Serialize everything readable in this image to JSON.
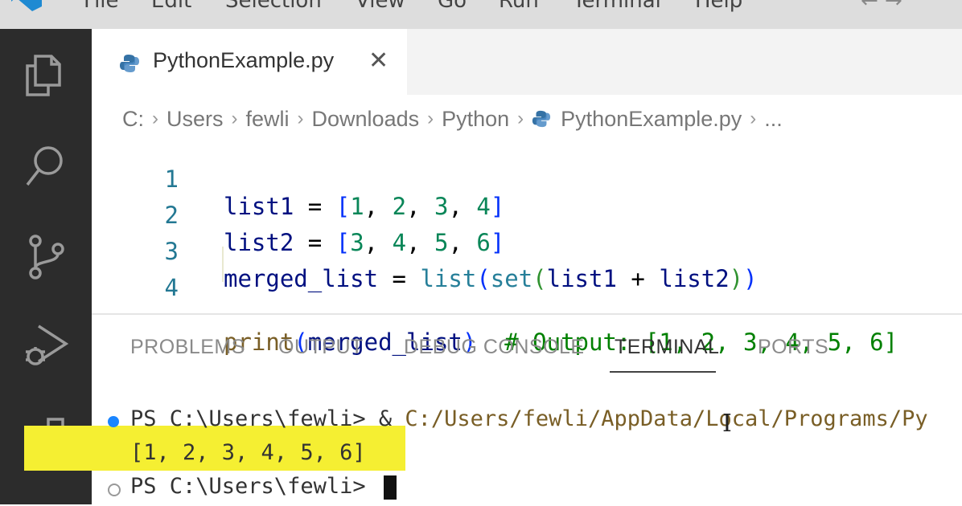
{
  "menubar": {
    "items": [
      "File",
      "Edit",
      "Selection",
      "View",
      "Go",
      "Run",
      "Terminal",
      "Help"
    ],
    "nav": "← →"
  },
  "activity": {
    "icons": [
      "explorer-icon",
      "search-icon",
      "source-control-icon",
      "run-debug-icon",
      "extensions-icon"
    ]
  },
  "tab": {
    "label": "PythonExample.py",
    "close": "✕"
  },
  "breadcrumb": {
    "parts": [
      "C:",
      "Users",
      "fewli",
      "Downloads",
      "Python"
    ],
    "file": "PythonExample.py",
    "more": "..."
  },
  "editor": {
    "lines": [
      {
        "num": "1",
        "text": "list1 = [1, 2, 3, 4]"
      },
      {
        "num": "2",
        "text": "list2 = [3, 4, 5, 6]"
      },
      {
        "num": "3",
        "text": "merged_list = list(set(list1 + list2))"
      },
      {
        "num": "4",
        "text": "print(merged_list)  # Output: [1, 2, 3, 4, 5, 6]"
      }
    ]
  },
  "panel": {
    "tabs": [
      "PROBLEMS",
      "OUTPUT",
      "DEBUG CONSOLE",
      "TERMINAL",
      "PORTS"
    ],
    "active": "TERMINAL"
  },
  "terminal": {
    "prompt1": "PS C:\\Users\\fewli> ",
    "cmd_amp": "& ",
    "cmd_path": "C:/Users/fewli/AppData/Local/Programs/Py",
    "output": "[1, 2, 3, 4, 5, 6]",
    "prompt2": "PS C:\\Users\\fewli> "
  },
  "colors": {
    "activitybar": "#2c2c2c",
    "highlight": "#f5ef32",
    "line_number": "#237893",
    "number": "#098658",
    "comment": "#008000"
  }
}
